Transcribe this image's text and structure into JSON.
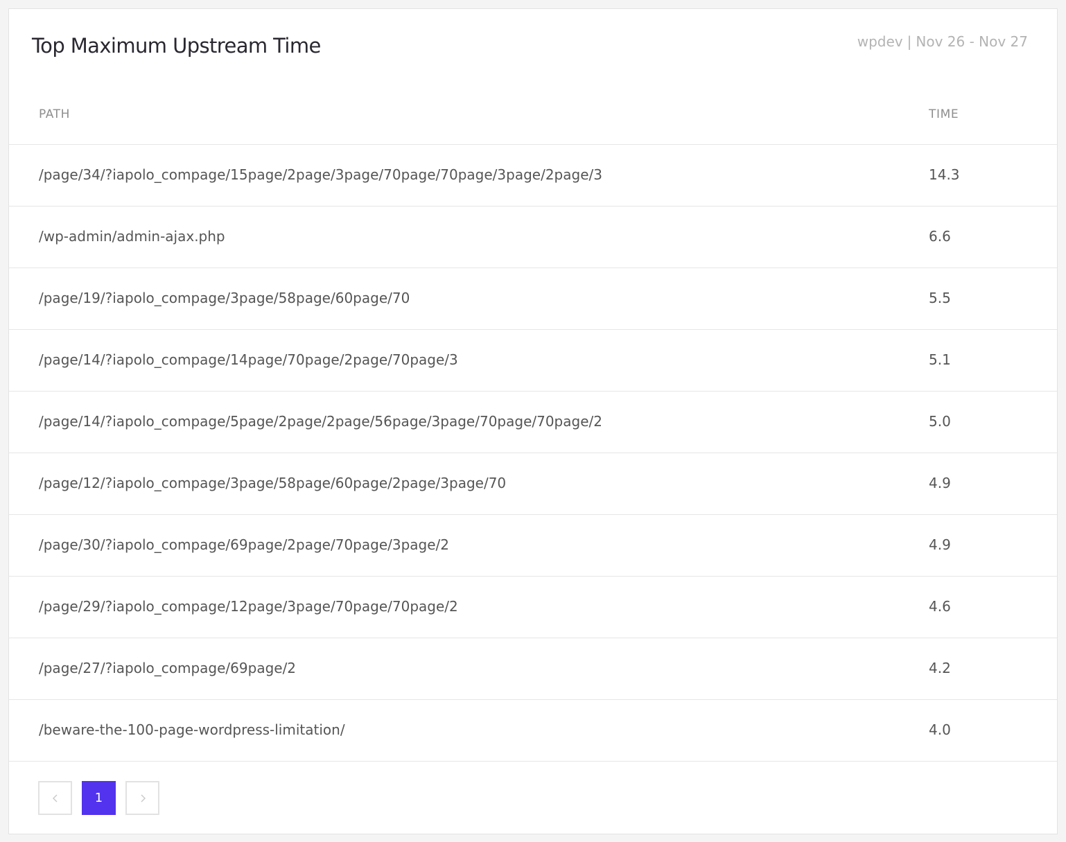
{
  "card": {
    "title": "Top Maximum Upstream Time",
    "site": "wpdev",
    "separator": "|",
    "date_range": "Nov 26 - Nov 27"
  },
  "table": {
    "headers": {
      "path": "PATH",
      "time": "TIME"
    },
    "rows": [
      {
        "path": "/page/34/?iapolo_compage/15page/2page/3page/70page/70page/3page/2page/3",
        "time": "14.3"
      },
      {
        "path": "/wp-admin/admin-ajax.php",
        "time": "6.6"
      },
      {
        "path": "/page/19/?iapolo_compage/3page/58page/60page/70",
        "time": "5.5"
      },
      {
        "path": "/page/14/?iapolo_compage/14page/70page/2page/70page/3",
        "time": "5.1"
      },
      {
        "path": "/page/14/?iapolo_compage/5page/2page/2page/56page/3page/70page/70page/2",
        "time": "5.0"
      },
      {
        "path": "/page/12/?iapolo_compage/3page/58page/60page/2page/3page/70",
        "time": "4.9"
      },
      {
        "path": "/page/30/?iapolo_compage/69page/2page/70page/3page/2",
        "time": "4.9"
      },
      {
        "path": "/page/29/?iapolo_compage/12page/3page/70page/70page/2",
        "time": "4.6"
      },
      {
        "path": "/page/27/?iapolo_compage/69page/2",
        "time": "4.2"
      },
      {
        "path": "/beware-the-100-page-wordpress-limitation/",
        "time": "4.0"
      }
    ]
  },
  "pagination": {
    "current_page": "1",
    "prev_icon": "chevron-left-icon",
    "next_icon": "chevron-right-icon",
    "active_color": "#5333ed"
  }
}
